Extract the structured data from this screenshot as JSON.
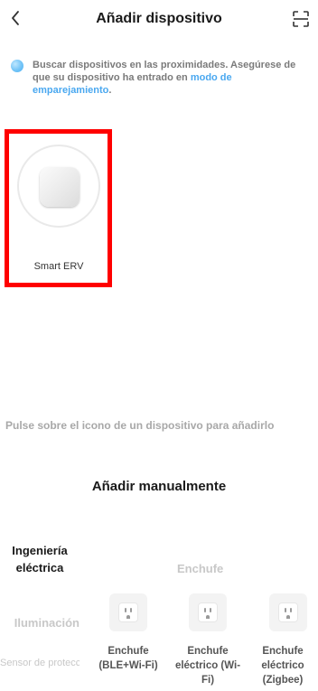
{
  "header": {
    "title": "Añadir dispositivo",
    "back_icon": "chevron-left-icon",
    "scan_icon": "scan-icon"
  },
  "hint": {
    "text": "Buscar dispositivos en las proximidades. Asegúrese de que su dispositivo ha entrado en ",
    "link": "modo de emparejamiento",
    "suffix": "."
  },
  "found_device": {
    "name": "Smart ERV"
  },
  "tap_hint": "Pulse sobre el icono de un dispositivo para añadirlo",
  "manual": {
    "title": "Añadir manualmente",
    "categories": [
      {
        "label": "Ingeniería eléctrica",
        "active": true
      },
      {
        "label": "Iluminación",
        "active": false
      },
      {
        "label": "Sensor de protección de se",
        "active": false
      }
    ],
    "group_title": "Enchufe",
    "devices": [
      {
        "label": "Enchufe (BLE+Wi-Fi)"
      },
      {
        "label": "Enchufe eléctrico (Wi-Fi)"
      },
      {
        "label": "Enchufe eléctrico (Zigbee)"
      }
    ]
  },
  "colors": {
    "accent": "#4aa8f0",
    "highlight": "#ff0000"
  }
}
